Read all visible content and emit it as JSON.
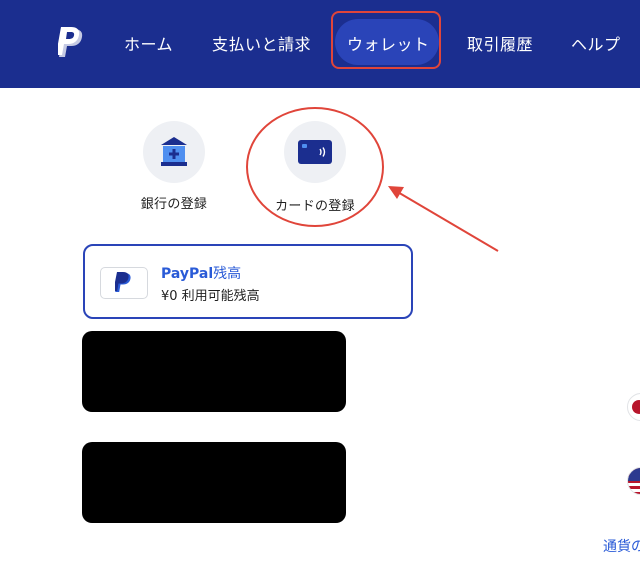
{
  "nav": {
    "items": [
      {
        "label": "ホーム"
      },
      {
        "label": "支払いと請求"
      },
      {
        "label": "ウォレット"
      },
      {
        "label": "取引履歴"
      },
      {
        "label": "ヘルプ"
      }
    ],
    "active_index": 2
  },
  "actions": {
    "bank_label": "銀行の登録",
    "card_label": "カードの登録"
  },
  "balance": {
    "title_brand": "PayPal",
    "title_suffix": "残高",
    "amount_text": "¥0 利用可能残高"
  },
  "currency": {
    "link_text": "通貨の"
  },
  "colors": {
    "nav_bg": "#1b2e8f",
    "accent_blue": "#2a5bd7",
    "highlight_red": "#e0453a"
  },
  "icons": {
    "logo": "paypal-logo-icon",
    "bank": "bank-building-icon",
    "card": "card-icon",
    "flag_jp": "flag-jp-icon",
    "flag_us": "flag-us-icon"
  }
}
